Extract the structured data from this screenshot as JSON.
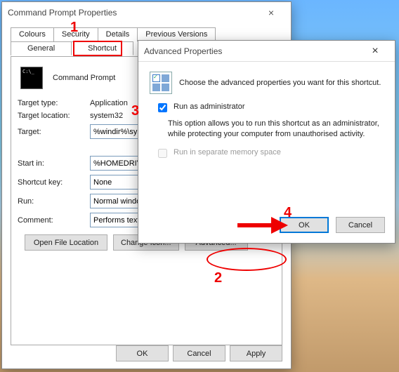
{
  "properties": {
    "title": "Command Prompt Properties",
    "tabs": {
      "general": "General",
      "shortcut": "Shortcut",
      "colours": "Colours",
      "security": "Security",
      "details": "Details",
      "previous": "Previous Versions"
    },
    "icon_label": "Command Prompt",
    "fields": {
      "target_type_lbl": "Target type:",
      "target_type_val": "Application",
      "target_location_lbl": "Target location:",
      "target_location_val": "system32",
      "target_lbl": "Target:",
      "target_val": "%windir%\\system",
      "startin_lbl": "Start in:",
      "startin_val": "%HOMEDRIVE%",
      "shortcutkey_lbl": "Shortcut key:",
      "shortcutkey_val": "None",
      "run_lbl": "Run:",
      "run_val": "Normal window",
      "comment_lbl": "Comment:",
      "comment_val": "Performs text-bas"
    },
    "buttons": {
      "open_file_location": "Open File Location",
      "change_icon": "Change Icon...",
      "advanced": "Advanced...",
      "ok": "OK",
      "cancel": "Cancel",
      "apply": "Apply"
    }
  },
  "advanced": {
    "title": "Advanced Properties",
    "intro": "Choose the advanced properties you want for this shortcut.",
    "run_as_admin_lbl": "Run as administrator",
    "run_as_admin_desc": "This option allows you to run this shortcut as an administrator, while protecting your computer from unauthorised activity.",
    "separate_mem_lbl": "Run in separate memory space",
    "ok": "OK",
    "cancel": "Cancel"
  },
  "annotations": {
    "n1": "1",
    "n2": "2",
    "n3": "3",
    "n4": "4"
  }
}
